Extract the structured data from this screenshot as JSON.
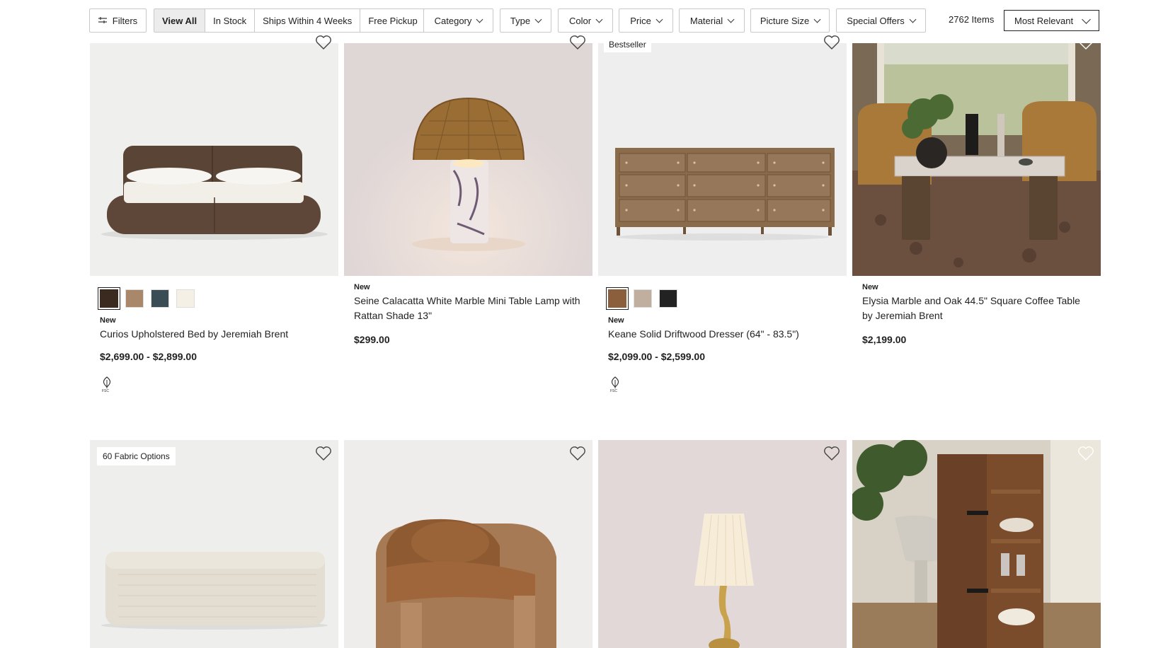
{
  "filters": {
    "filters_label": "Filters",
    "segments": [
      "View All",
      "In Stock",
      "Ships Within 4 Weeks",
      "Free Pickup"
    ],
    "dropdowns": [
      "Category",
      "Type",
      "Color",
      "Price",
      "Material",
      "Picture Size",
      "Special Offers"
    ],
    "item_count": "2762 Items",
    "sort_label": "Most Relevant"
  },
  "products_row1": [
    {
      "name": "Curios Upholstered Bed by Jeremiah Brent",
      "new_label": "New",
      "price": "$2,699.00 - $2,899.00",
      "swatches": [
        "#3b2a20",
        "#a8876a",
        "#3a4d55",
        "#f5f0e6"
      ],
      "icon": "fsc-certified-icon"
    },
    {
      "name": "Seine Calacatta White Marble Mini Table Lamp with Rattan Shade 13\"",
      "new_label": "New",
      "price": "$299.00"
    },
    {
      "badge": "Bestseller",
      "name": "Keane Solid Driftwood Dresser (64\" - 83.5\")",
      "new_label": "New",
      "price": "$2,099.00 - $2,599.00",
      "swatches": [
        "#8b5e3c",
        "#c0ae9e",
        "#222222"
      ],
      "icon": "fsc-certified-icon"
    },
    {
      "name": "Elysia Marble and Oak 44.5\" Square Coffee Table by Jeremiah Brent",
      "new_label": "New",
      "price": "$2,199.00"
    }
  ],
  "products_row2": [
    {
      "badge": "60 Fabric Options"
    }
  ]
}
